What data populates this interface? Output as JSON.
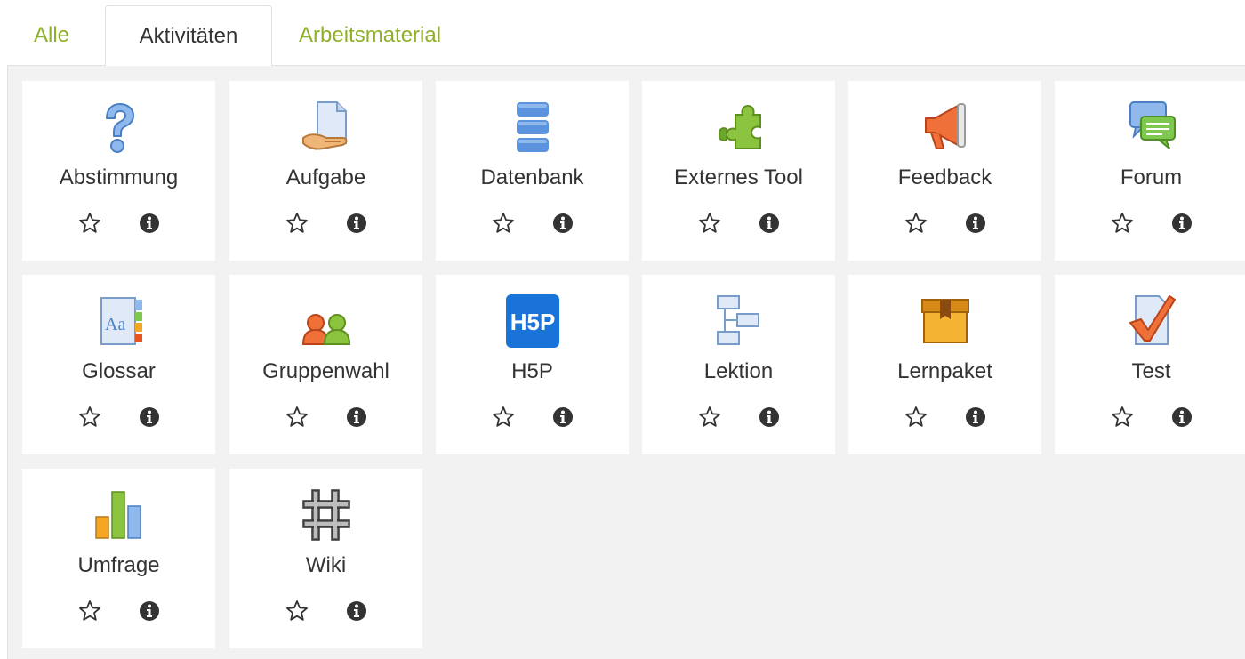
{
  "tabs": [
    {
      "label": "Alle",
      "active": false
    },
    {
      "label": "Aktivitäten",
      "active": true
    },
    {
      "label": "Arbeitsmaterial",
      "active": false
    }
  ],
  "activities": [
    {
      "label": "Abstimmung",
      "icon": "question-icon"
    },
    {
      "label": "Aufgabe",
      "icon": "assignment-icon"
    },
    {
      "label": "Datenbank",
      "icon": "database-icon"
    },
    {
      "label": "Externes Tool",
      "icon": "puzzle-icon"
    },
    {
      "label": "Feedback",
      "icon": "megaphone-icon"
    },
    {
      "label": "Forum",
      "icon": "forum-icon"
    },
    {
      "label": "Glossar",
      "icon": "glossary-icon"
    },
    {
      "label": "Gruppenwahl",
      "icon": "group-icon"
    },
    {
      "label": "H5P",
      "icon": "h5p-icon",
      "icon_text": "H5P"
    },
    {
      "label": "Lektion",
      "icon": "lesson-icon"
    },
    {
      "label": "Lernpaket",
      "icon": "package-icon"
    },
    {
      "label": "Test",
      "icon": "quiz-icon"
    },
    {
      "label": "Umfrage",
      "icon": "survey-icon"
    },
    {
      "label": "Wiki",
      "icon": "wiki-icon"
    }
  ],
  "colors": {
    "accent_link": "#8fb02b",
    "text": "#333333",
    "grid_background": "#f2f2f2",
    "card_background": "#ffffff"
  }
}
